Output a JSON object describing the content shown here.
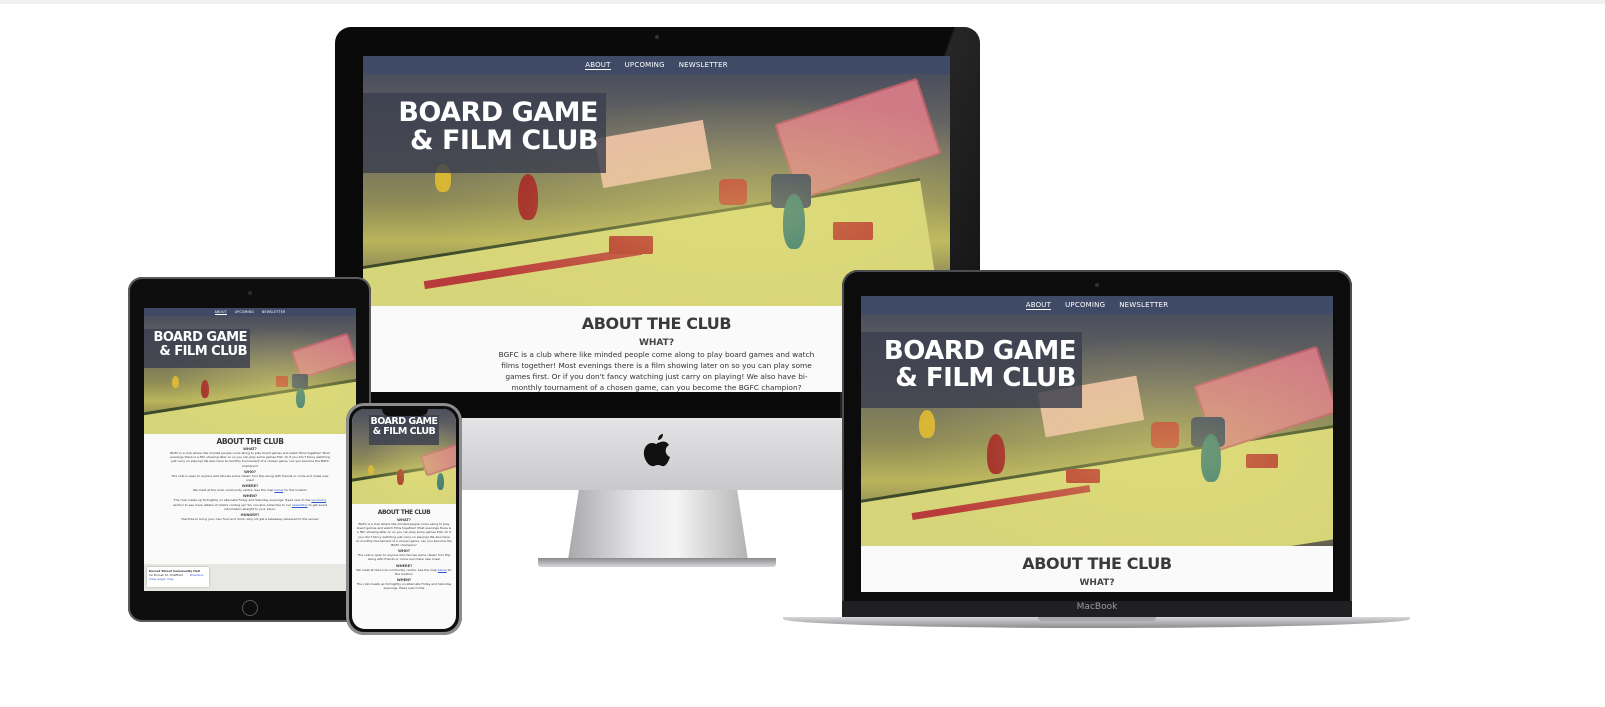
{
  "nav": {
    "items": [
      "ABOUT",
      "UPCOMING",
      "NEWSLETTER"
    ],
    "active": "ABOUT"
  },
  "hero": {
    "title_line1": "BOARD GAME",
    "title_line2": "& FILM CLUB"
  },
  "about": {
    "heading": "ABOUT THE CLUB",
    "what_heading": "WHAT?",
    "what_text": "BGFC is a club where like minded people come along to play board games and watch films together! Most evenings there is a film showing later on so you can play some games first. Or if you don't fancy watching just carry on playing! We also have bi-monthly tournament of a chosen game, can you become the BGFC champion?",
    "who_heading": "WHO?",
    "who_text": "The club is open to anyone who fancies some classic fun! Pop along with friends or come and make new ones!",
    "where_heading": "WHERE?",
    "where_text_pre": "We meet at the local community centre. See the map ",
    "where_link": "below",
    "where_text_post": " for the location",
    "when_heading": "WHEN?",
    "when_text_pre": "The club meets up fortnightly on alternate Friday and Saturday evenings. Head over to the ",
    "when_link1": "upcoming",
    "when_text_mid": " section to see more details of what's coming up! You can also subscribe to our ",
    "when_link2": "newsletter",
    "when_text_post": " to get event information straight to your inbox.",
    "hungry_heading": "HUNGRY?",
    "hungry_text": "Feel free to bring your own food and drink, why not get a takeaway delivered to the venue!"
  },
  "map": {
    "place": "Dorset Street Community Hall",
    "address": "12 Dorset St, Sheffield",
    "link": "View larger map",
    "directions": "Directions"
  },
  "macbook_label": "MacBook",
  "colors": {
    "nav": "#3f4b66",
    "title_box": "#3a3e4e",
    "link": "#2d5bd1"
  }
}
